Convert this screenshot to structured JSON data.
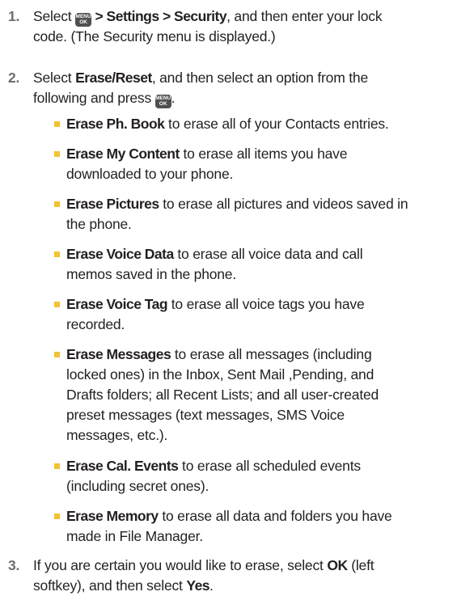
{
  "icons": {
    "menu_key_top": "MENU",
    "menu_key_bottom": "OK",
    "bullet_color": "#f1c232"
  },
  "step1": {
    "num": "1.",
    "pre": "Select ",
    "bold": " > Settings > Security",
    "post1": ", and then enter your lock",
    "line2": "code. (The Security menu is displayed.)"
  },
  "step2": {
    "num": "2.",
    "pre": "Select ",
    "bold": "Erase/Reset",
    "post1": ", and then select an option from the",
    "line2": "following and press ",
    "end": "."
  },
  "options": [
    {
      "name": "Erase Ph. Book",
      "lines": [
        " to erase all of your Contacts entries."
      ]
    },
    {
      "name": "Erase My Content",
      "lines": [
        " to erase all items you have",
        "downloaded to your phone."
      ]
    },
    {
      "name": "Erase Pictures",
      "lines": [
        " to erase all pictures and videos saved in",
        "the phone."
      ]
    },
    {
      "name": "Erase Voice Data",
      "lines": [
        " to erase all voice data and call",
        "memos saved in the phone."
      ]
    },
    {
      "name": "Erase Voice Tag",
      "lines": [
        " to erase all voice tags you have",
        "recorded."
      ]
    },
    {
      "name": "Erase Messages",
      "lines": [
        " to erase all messages (including",
        "locked ones) in the Inbox, Sent Mail ,Pending, and",
        "Drafts folders; all Recent Lists; and all user-created",
        "preset messages (text messages, SMS Voice",
        "messages, etc.)."
      ]
    },
    {
      "name": "Erase Cal. Events",
      "lines": [
        " to erase all scheduled events",
        "(including secret ones)."
      ]
    },
    {
      "name": "Erase Memory",
      "lines": [
        " to erase all data and folders you have",
        "made in File Manager."
      ]
    }
  ],
  "step3": {
    "num": "3.",
    "pre": "If you are certain you would like to erase, select ",
    "bold1": "OK",
    "post1": " (left",
    "line2a": "softkey), and then select ",
    "bold2": "Yes",
    "end": "."
  }
}
